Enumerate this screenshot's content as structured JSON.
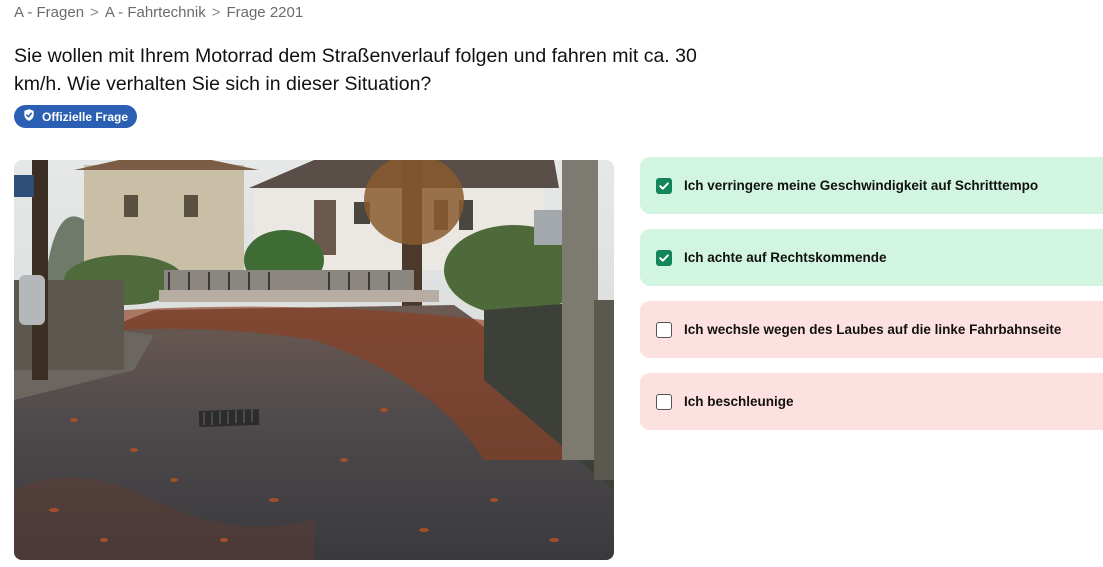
{
  "breadcrumb": {
    "items": [
      "A - Fragen",
      "A - Fahrtechnik",
      "Frage 2201"
    ],
    "separator": ">"
  },
  "question": {
    "text": "Sie wollen mit Ihrem Motorrad dem Straßenverlauf folgen und fahren mit ca. 30 km/h. Wie verhalten Sie sich in dieser Situation?"
  },
  "badge": {
    "label": "Offizielle Frage",
    "icon": "shield-check-icon",
    "color": "#2b5fb3"
  },
  "answers": [
    {
      "label": "Ich verringere meine Geschwindigkeit auf Schritttempo",
      "checked": true,
      "state": "correct"
    },
    {
      "label": "Ich achte auf Rechtskommende",
      "checked": true,
      "state": "correct"
    },
    {
      "label": "Ich wechsle wegen des Laubes auf die linke Fahrbahnseite",
      "checked": false,
      "state": "wrong"
    },
    {
      "label": "Ich beschleunige",
      "checked": false,
      "state": "wrong"
    }
  ],
  "colors": {
    "correct_bg": "#d1f5e0",
    "wrong_bg": "#fde0e0",
    "checkbox_checked": "#12855a"
  }
}
